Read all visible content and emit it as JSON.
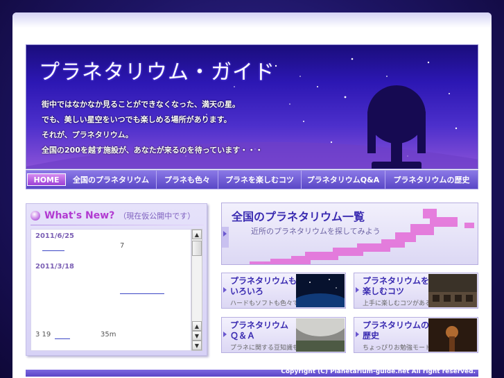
{
  "header": {
    "title": "プラネタリウム・ガイド",
    "tagline": [
      "街中ではなかなか見ることができなくなった、満天の星。",
      "でも、美しい星空をいつでも楽しめる場所があります。",
      "それが、プラネタリウム。",
      "全国の200を越す施設が、あなたが来るのを待っています・・・"
    ]
  },
  "nav": {
    "items": [
      {
        "label": "HOME",
        "active": true
      },
      {
        "label": "全国のプラネタリウム"
      },
      {
        "label": "プラネも色々"
      },
      {
        "label": "プラネを楽しむコツ"
      },
      {
        "label": "プラネタリウムQ&A"
      },
      {
        "label": "プラネタリウムの歴史"
      }
    ]
  },
  "news": {
    "title": "What's New?",
    "subtitle": "（現在仮公開中です）",
    "entries": [
      {
        "date": "2011/6/25",
        "text": "7"
      },
      {
        "date": "2011/3/18",
        "text": ""
      },
      {
        "date": "",
        "text": "3 19",
        "text2": "35m"
      }
    ]
  },
  "banner_main": {
    "title": "全国のプラネタリウム一覧",
    "subtitle": "近所のプラネタリウムを探してみよう"
  },
  "cards": [
    {
      "title": "プラネタリウムも\nいろいろ",
      "subtitle": "ハードもソフトも色々です"
    },
    {
      "title": "プラネタリウムを\n楽しむコツ",
      "subtitle": "上手に楽しむコツがある"
    },
    {
      "title": "プラネタリウム\nＱ＆Ａ",
      "subtitle": "プラネに関する豆知識も"
    },
    {
      "title": "プラネタリウムの\n歴史",
      "subtitle": "ちょっぴりお勉強モード"
    }
  ],
  "footer": {
    "copyright": "Copyright (C) Planetarium-guide.net All right reserved."
  },
  "colors": {
    "accent": "#3a2bb1",
    "nav": "#6a55d2",
    "highlight": "#b13ad1"
  }
}
